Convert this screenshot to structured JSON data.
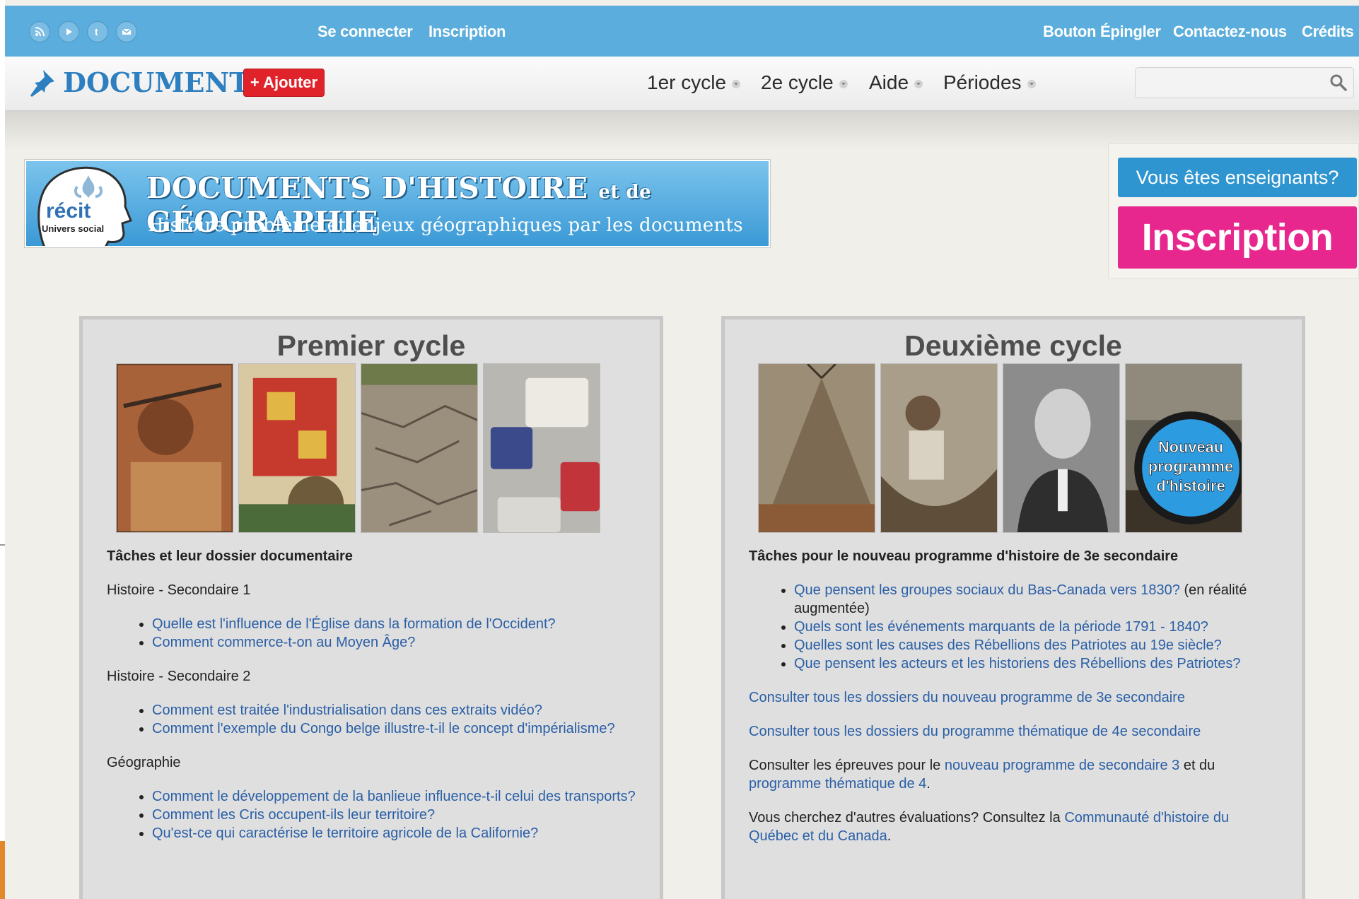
{
  "topbar": {
    "social_icons": [
      "rss-icon",
      "youtube-icon",
      "tumblr-icon",
      "email-icon"
    ],
    "left_links": [
      "Se connecter",
      "Inscription"
    ],
    "right_links": [
      "Bouton Épingler",
      "Contactez-nous",
      "Crédits"
    ]
  },
  "nav": {
    "logo": "DOCUMENTS",
    "add_button": "+ Ajouter",
    "menus": [
      "1er cycle",
      "2e cycle",
      "Aide",
      "Périodes"
    ],
    "search_placeholder": ""
  },
  "banner": {
    "logo_text": "récit",
    "logo_sub": "Univers social",
    "title_a": "DOCUMENTS D'HISTOIRE",
    "title_mid": "et de",
    "title_b": "GÉOGRAPHIE",
    "subtitle": "Histoire problème et enjeux géographiques par les documents"
  },
  "teachers": {
    "question": "Vous êtes enseignants?",
    "signup": "Inscription"
  },
  "premier": {
    "title": "Premier cycle",
    "heading": "Tâches et leur dossier documentaire",
    "sections": [
      {
        "label": "Histoire - Secondaire 1",
        "links": [
          "Quelle est l'influence de l'Église dans la formation de l'Occident?",
          "Comment commerce-t-on au Moyen Âge?"
        ]
      },
      {
        "label": "Histoire - Secondaire 2",
        "links": [
          "Comment est traitée l'industrialisation dans ces extraits vidéo?",
          "Comment l'exemple du Congo belge illustre-t-il le concept d'impérialisme?"
        ]
      },
      {
        "label": "Géographie",
        "links": [
          "Comment le développement de la banlieue influence-t-il celui des transports?",
          "Comment les Cris occupent-ils leur territoire?",
          "Qu'est-ce qui caractérise le territoire agricole de la Californie?"
        ]
      }
    ]
  },
  "deuxieme": {
    "title": "Deuxième cycle",
    "badge": [
      "Nouveau",
      "programme",
      "d'histoire"
    ],
    "heading": "Tâches pour le nouveau programme d'histoire de 3e secondaire",
    "links": [
      {
        "text": "Que pensent les groupes sociaux du Bas-Canada vers 1830?",
        "suffix": " (en réalité augmentée)"
      },
      {
        "text": "Quels sont les événements marquants de la période 1791 - 1840?",
        "suffix": ""
      },
      {
        "text": "Quelles sont les causes des Rébellions des Patriotes au 19e siècle?",
        "suffix": ""
      },
      {
        "text": "Que pensent les acteurs et les historiens des Rébellions des Patriotes?",
        "suffix": ""
      }
    ],
    "consult_3e": "Consulter tous les dossiers du nouveau programme de 3e secondaire",
    "consult_4e": "Consulter tous les dossiers du programme thématique de 4e secondaire",
    "epreuves_pre": "Consulter les épreuves pour le ",
    "epreuves_link1": "nouveau programme de secondaire 3",
    "epreuves_mid": " et du ",
    "epreuves_link2": "programme thématique de 4",
    "epreuves_end": ".",
    "autres_pre": "Vous cherchez d'autres évaluations? Consultez la ",
    "autres_link": "Communauté d'histoire du Québec et du Canada",
    "autres_end": "."
  }
}
